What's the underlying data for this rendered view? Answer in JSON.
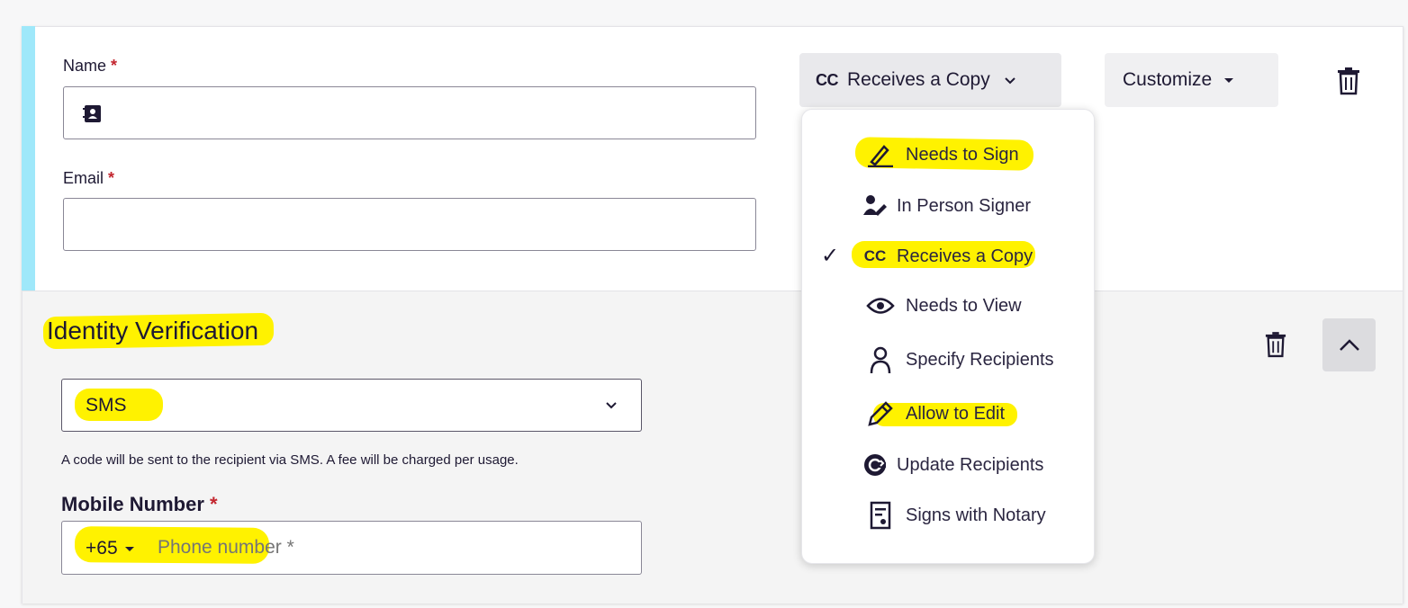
{
  "recipient": {
    "name_label": "Name",
    "email_label": "Email",
    "required_mark": "*",
    "name_value": "",
    "email_value": ""
  },
  "role_button": {
    "badge": "CC",
    "label": "Receives a Copy"
  },
  "customize_button": {
    "label": "Customize"
  },
  "role_menu": {
    "items": [
      {
        "label": "Needs to Sign",
        "icon": "pen-icon",
        "highlighted": true,
        "selected": false
      },
      {
        "label": "In Person Signer",
        "icon": "in-person-signer-icon",
        "highlighted": false,
        "selected": false
      },
      {
        "label": "Receives a Copy",
        "icon": "cc-icon",
        "highlighted": true,
        "selected": true
      },
      {
        "label": "Needs to View",
        "icon": "eye-icon",
        "highlighted": false,
        "selected": false
      },
      {
        "label": "Specify Recipients",
        "icon": "person-outline-icon",
        "highlighted": false,
        "selected": false
      },
      {
        "label": "Allow to Edit",
        "icon": "pencil-icon",
        "highlighted": true,
        "selected": false
      },
      {
        "label": "Update Recipients",
        "icon": "update-recipients-icon",
        "highlighted": false,
        "selected": false
      },
      {
        "label": "Signs with Notary",
        "icon": "notary-icon",
        "highlighted": false,
        "selected": false
      }
    ],
    "check_mark": "✓",
    "cc_badge": "CC"
  },
  "identity_verification": {
    "title": "Identity Verification",
    "method_value": "SMS",
    "hint": "A code will be sent to the recipient via SMS. A fee will be charged per usage.",
    "mobile_label": "Mobile Number",
    "country_code": "+65",
    "phone_placeholder": "Phone number *"
  },
  "colors": {
    "accent_bar": "#9fe8fa",
    "highlighter": "#fff200",
    "required": "#c3262f",
    "text": "#1e1933"
  }
}
